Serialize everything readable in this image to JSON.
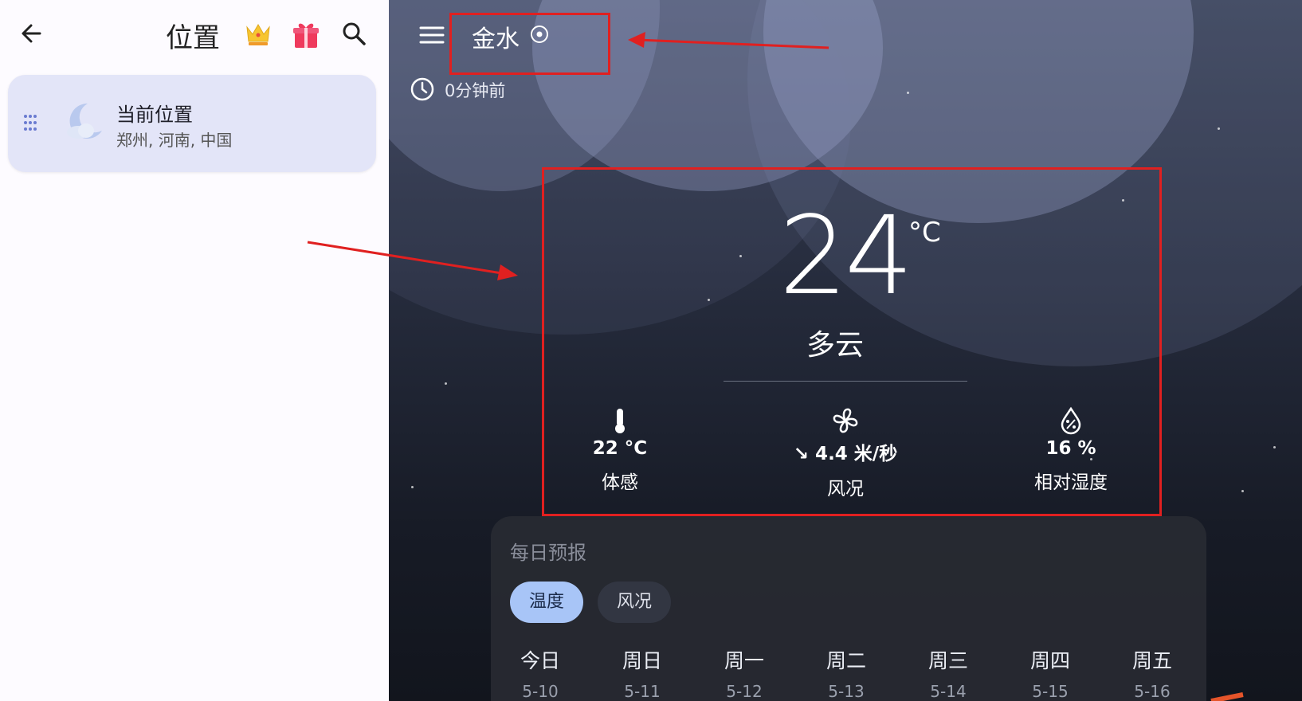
{
  "left_panel": {
    "title": "位置",
    "icons": {
      "back": "back-arrow-icon",
      "vip": "crown-icon",
      "gift": "gift-icon",
      "search": "search-icon"
    },
    "location_item": {
      "name": "当前位置",
      "subtitle": "郑州, 河南, 中国",
      "icon": "moon-cloud-icon"
    }
  },
  "weather": {
    "city": "金水",
    "updated": "0分钟前",
    "temperature": "24",
    "temp_unit": "°C",
    "condition": "多云",
    "stats": [
      {
        "value": "22 °C",
        "label": "体感",
        "icon": "thermometer-icon"
      },
      {
        "value": "↘ 4.4 米/秒",
        "label": "风况",
        "icon": "fan-icon"
      },
      {
        "value": "16 %",
        "label": "相对湿度",
        "icon": "humidity-drop-icon"
      }
    ]
  },
  "daily": {
    "title": "每日预报",
    "tabs": [
      "温度",
      "风况"
    ],
    "days": [
      {
        "name": "今日",
        "date": "5-10"
      },
      {
        "name": "周日",
        "date": "5-11"
      },
      {
        "name": "周一",
        "date": "5-12"
      },
      {
        "name": "周二",
        "date": "5-13"
      },
      {
        "name": "周三",
        "date": "5-14"
      },
      {
        "name": "周四",
        "date": "5-15"
      },
      {
        "name": "周五",
        "date": "5-16"
      }
    ]
  },
  "colors": {
    "annotation_red": "#e02020",
    "card_bg": "#e3e5f8",
    "chip_active": "#a8c5f7"
  }
}
